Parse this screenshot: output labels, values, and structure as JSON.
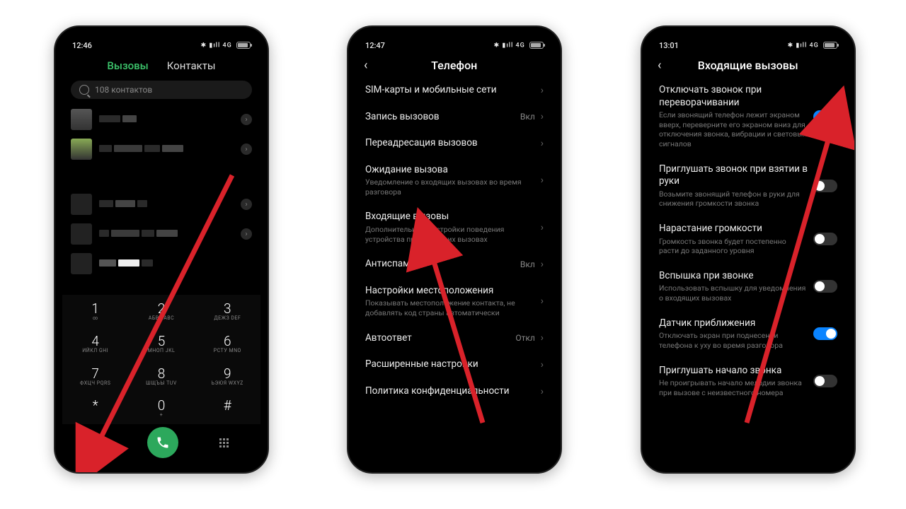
{
  "phone1": {
    "time": "12:46",
    "net": "4G",
    "tabs": {
      "calls": "Вызовы",
      "contacts": "Контакты"
    },
    "search_placeholder": "108 контактов",
    "dialpad": [
      [
        {
          "d": "1",
          "s": "∞"
        },
        {
          "d": "2",
          "s": "АБВГ\nABC"
        },
        {
          "d": "3",
          "s": "ДЕЖЗ\nDEF"
        }
      ],
      [
        {
          "d": "4",
          "s": "ИЙКЛ\nGHI"
        },
        {
          "d": "5",
          "s": "МНОП\nJKL"
        },
        {
          "d": "6",
          "s": "РСТУ\nMNO"
        }
      ],
      [
        {
          "d": "7",
          "s": "ФХЦЧ\nPQRS"
        },
        {
          "d": "8",
          "s": "ШЩЪЫ\nTUV"
        },
        {
          "d": "9",
          "s": "ЬЭЮЯ\nWXYZ"
        }
      ],
      [
        {
          "d": "*",
          "s": ""
        },
        {
          "d": "0",
          "s": "+"
        },
        {
          "d": "#",
          "s": ""
        }
      ]
    ]
  },
  "phone2": {
    "time": "12:47",
    "net": "4G",
    "title": "Телефон",
    "items": [
      {
        "title": "SIM-карты и мобильные сети",
        "desc": "",
        "value": ""
      },
      {
        "title": "Запись вызовов",
        "desc": "",
        "value": "Вкл"
      },
      {
        "title": "Переадресация вызовов",
        "desc": "",
        "value": ""
      },
      {
        "title": "Ожидание вызова",
        "desc": "Уведомление о входящих вызовах во время разговора",
        "value": ""
      },
      {
        "title": "Входящие вызовы",
        "desc": "Дополнительные настройки поведения устройства при входящих вызовах",
        "value": ""
      },
      {
        "title": "Антиспам",
        "desc": "",
        "value": "Вкл"
      },
      {
        "title": "Настройки местоположения",
        "desc": "Показывать местоположение контакта, не добавлять код страны автоматически",
        "value": ""
      },
      {
        "title": "Автоответ",
        "desc": "",
        "value": "Откл"
      },
      {
        "title": "Расширенные настройки",
        "desc": "",
        "value": ""
      },
      {
        "title": "Политика конфиденциальности",
        "desc": "",
        "value": ""
      }
    ]
  },
  "phone3": {
    "time": "13:01",
    "net": "4G",
    "title": "Входящие вызовы",
    "items": [
      {
        "title": "Отключать звонок при переворачивании",
        "desc": "Если звонящий телефон лежит экраном вверх, переверните его экраном вниз для отключения звонка, вибрации и световых сигналов",
        "on": true
      },
      {
        "title": "Приглушать звонок при взятии в руки",
        "desc": "Возьмите звонящий телефон в руки для снижения громкости звонка",
        "on": false
      },
      {
        "title": "Нарастание громкости",
        "desc": "Громкость звонка будет постепенно расти до заданного уровня",
        "on": false
      },
      {
        "title": "Вспышка при звонке",
        "desc": "Использовать вспышку для уведомления о входящих вызовах",
        "on": false
      },
      {
        "title": "Датчик приближения",
        "desc": "Отключать экран при поднесении телефона к уху во время разговора",
        "on": true
      },
      {
        "title": "Приглушать начало звонка",
        "desc": "Не проигрывать начало мелодии звонка при вызове с неизвестного номера",
        "on": false
      }
    ]
  }
}
